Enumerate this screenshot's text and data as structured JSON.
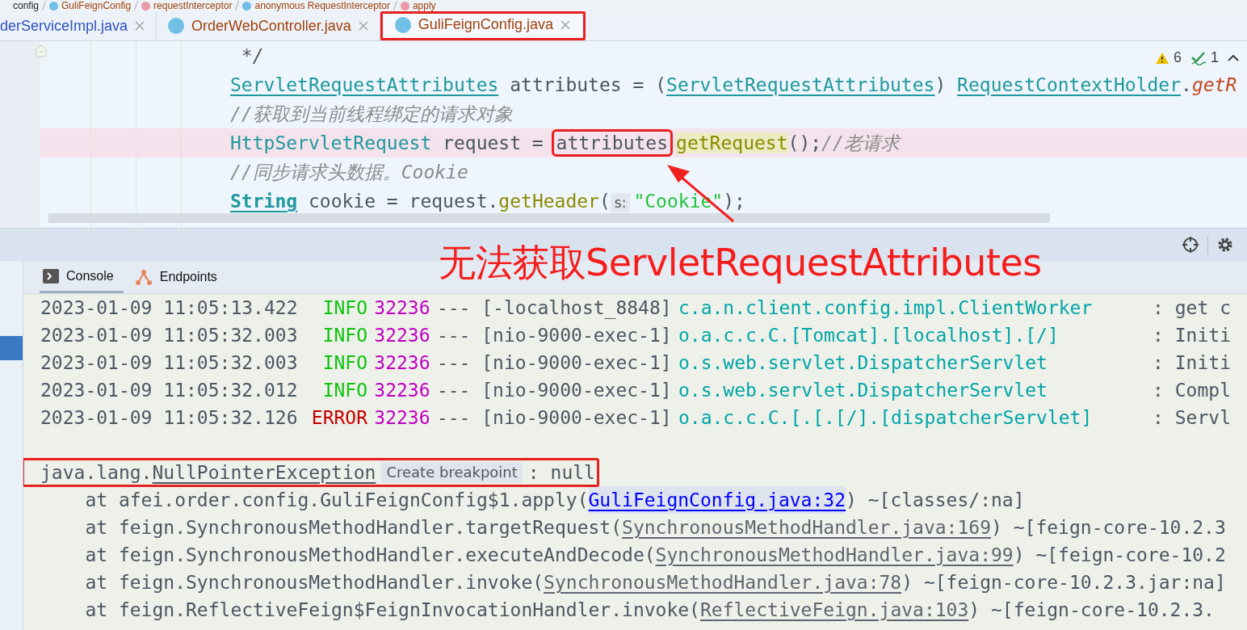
{
  "breadcrumbs": [
    {
      "label": "config",
      "kind": "package"
    },
    {
      "label": "GuliFeignConfig",
      "kind": "class"
    },
    {
      "label": "requestInterceptor",
      "kind": "method"
    },
    {
      "label": "anonymous RequestInterceptor",
      "kind": "class"
    },
    {
      "label": "apply",
      "kind": "method"
    }
  ],
  "tabs": [
    {
      "label": "derServiceImpl.java",
      "selected": false,
      "icon": false,
      "color": "#2b52c2",
      "annotated": false
    },
    {
      "label": "OrderWebController.java",
      "selected": false,
      "icon": true,
      "color": "#a0410c",
      "annotated": false
    },
    {
      "label": "GuliFeignConfig.java",
      "selected": true,
      "icon": true,
      "color": "#a0410c",
      "annotated": true
    }
  ],
  "editor": {
    "warnings": "6",
    "checks": "1",
    "lines": [
      {
        "highlighted": false,
        "tokens": [
          {
            "kind": "comment-doc",
            "text": " */"
          }
        ]
      },
      {
        "highlighted": false,
        "tokens": [
          {
            "kind": "type",
            "text": "ServletRequestAttributes"
          },
          {
            "kind": "plain",
            "text": " attributes = ("
          },
          {
            "kind": "type",
            "text": "ServletRequestAttributes"
          },
          {
            "kind": "plain",
            "text": ") "
          },
          {
            "kind": "type",
            "text": "RequestContextHolder"
          },
          {
            "kind": "plain",
            "text": "."
          },
          {
            "kind": "static",
            "text": "getR"
          }
        ]
      },
      {
        "highlighted": false,
        "tokens": [
          {
            "kind": "comment",
            "text": "//获取到当前线程绑定的请求对象"
          }
        ]
      },
      {
        "highlighted": true,
        "tokens": [
          {
            "kind": "class",
            "text": "HttpServletRequest"
          },
          {
            "kind": "plain",
            "text": " request = "
          },
          {
            "kind": "boxed",
            "text": "attributes"
          },
          {
            "kind": "method-hl",
            "text": "getRequest"
          },
          {
            "kind": "plain",
            "text": "();"
          },
          {
            "kind": "comment",
            "text": "//老请求"
          }
        ]
      },
      {
        "highlighted": false,
        "tokens": [
          {
            "kind": "comment",
            "text": "//同步请求头数据。Cookie"
          }
        ]
      },
      {
        "highlighted": false,
        "tokens": [
          {
            "kind": "type-bold",
            "text": "String"
          },
          {
            "kind": "plain",
            "text": " cookie = request."
          },
          {
            "kind": "method",
            "text": "getHeader"
          },
          {
            "kind": "plain",
            "text": "("
          },
          {
            "kind": "hint",
            "text": "s:"
          },
          {
            "kind": "string",
            "text": "\"Cookie\""
          },
          {
            "kind": "plain",
            "text": ");"
          }
        ]
      }
    ]
  },
  "caption": "无法获取ServletRequestAttributes",
  "console_tabs": [
    {
      "label": "Console",
      "kind": "console",
      "selected": true
    },
    {
      "label": "Endpoints",
      "kind": "endpoints",
      "selected": false
    }
  ],
  "log": [
    {
      "kind": "info",
      "time": "2023-01-09 11:05:13.422",
      "level": "INFO",
      "pid": "32236",
      "thread": "--- [-localhost_8848]",
      "logger": "c.a.n.client.config.impl.ClientWorker",
      "message": ": get c"
    },
    {
      "kind": "info",
      "time": "2023-01-09 11:05:32.003",
      "level": "INFO",
      "pid": "32236",
      "thread": "--- [nio-9000-exec-1]",
      "logger": "o.a.c.c.C.[Tomcat].[localhost].[/]",
      "message": ": Initi"
    },
    {
      "kind": "info",
      "time": "2023-01-09 11:05:32.003",
      "level": "INFO",
      "pid": "32236",
      "thread": "--- [nio-9000-exec-1]",
      "logger": "o.s.web.servlet.DispatcherServlet",
      "message": ": Initi"
    },
    {
      "kind": "info",
      "time": "2023-01-09 11:05:32.012",
      "level": "INFO",
      "pid": "32236",
      "thread": "--- [nio-9000-exec-1]",
      "logger": "o.s.web.servlet.DispatcherServlet",
      "message": ": Compl"
    },
    {
      "kind": "error",
      "time": "2023-01-09 11:05:32.126",
      "level": "ERROR",
      "pid": "32236",
      "thread": "--- [nio-9000-exec-1]",
      "logger": "o.a.c.c.C.[.[.[/].[dispatcherServlet]",
      "message": ": Servl"
    }
  ],
  "exception": {
    "prefix": "java.lang.",
    "name": "NullPointerException",
    "hint": "Create breakpoint",
    "suffix": ": null",
    "annotated": true
  },
  "stack": [
    {
      "kind": "project",
      "before": "at afei.order.config.GuliFeignConfig$1.apply(",
      "link": "GuliFeignConfig.java:32",
      "after": ") ~[classes/:na]"
    },
    {
      "kind": "library",
      "before": "at feign.SynchronousMethodHandler.targetRequest(",
      "link": "SynchronousMethodHandler.java:169",
      "after": ") ~[feign-core-10.2.3"
    },
    {
      "kind": "library",
      "before": "at feign.SynchronousMethodHandler.executeAndDecode(",
      "link": "SynchronousMethodHandler.java:99",
      "after": ") ~[feign-core-10.2"
    },
    {
      "kind": "library",
      "before": "at feign.SynchronousMethodHandler.invoke(",
      "link": "SynchronousMethodHandler.java:78",
      "after": ") ~[feign-core-10.2.3.jar:na]"
    },
    {
      "kind": "library",
      "before": "at feign.ReflectiveFeign$FeignInvocationHandler.invoke(",
      "link": "ReflectiveFeign.java:103",
      "after": ") ~[feign-core-10.2.3."
    }
  ]
}
